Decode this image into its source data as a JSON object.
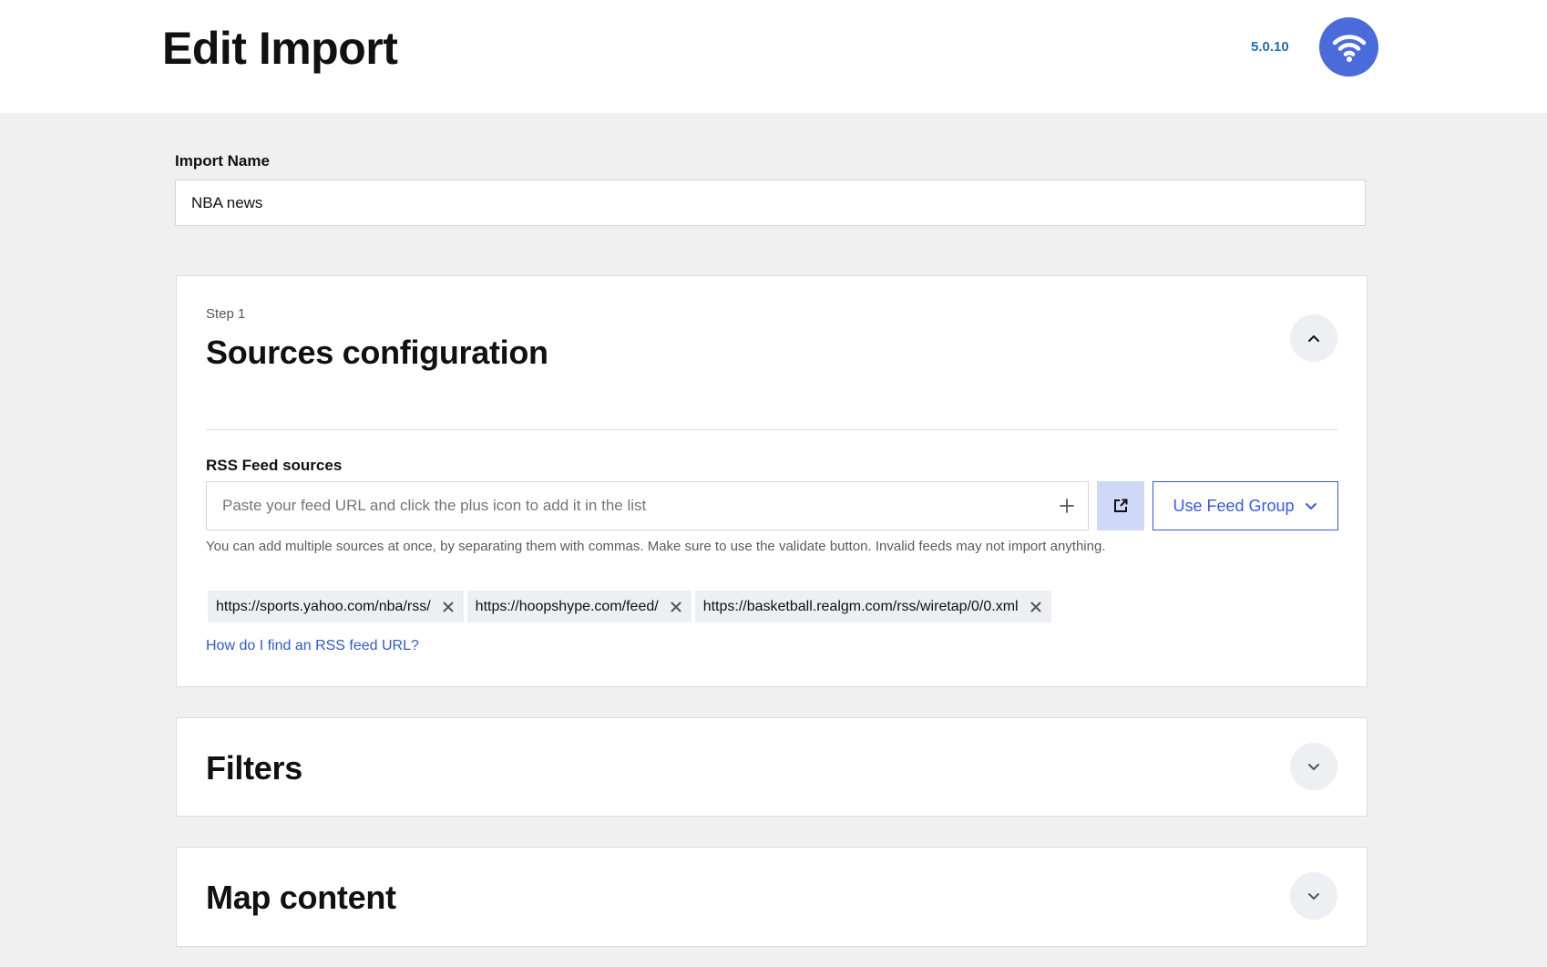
{
  "header": {
    "title": "Edit Import",
    "version": "5.0.10",
    "logo_icon": "wifi-icon",
    "logo_color": "#4a6cdb"
  },
  "import_name": {
    "label": "Import Name",
    "value": "NBA news"
  },
  "sources": {
    "step_label": "Step 1",
    "title": "Sources configuration",
    "expanded": true,
    "rss_label": "RSS Feed sources",
    "feed_input_placeholder": "Paste your feed URL and click the plus icon to add it in the list",
    "feed_input_value": "",
    "use_feed_group_label": "Use Feed Group",
    "help_text": "You can add multiple sources at once, by separating them with commas. Make sure to use the validate button. Invalid feeds may not import anything.",
    "feeds": [
      "https://sports.yahoo.com/nba/rss/",
      "https://hoopshype.com/feed/",
      "https://basketball.realgm.com/rss/wiretap/0/0.xml"
    ],
    "help_link": "How do I find an RSS feed URL?"
  },
  "filters": {
    "title": "Filters",
    "expanded": false
  },
  "map_content": {
    "title": "Map content",
    "expanded": false
  },
  "colors": {
    "accent": "#3858e9",
    "validate_bg": "#cfd8f7",
    "version_text": "#1f6fb2",
    "page_bg": "#f0f0f1"
  }
}
